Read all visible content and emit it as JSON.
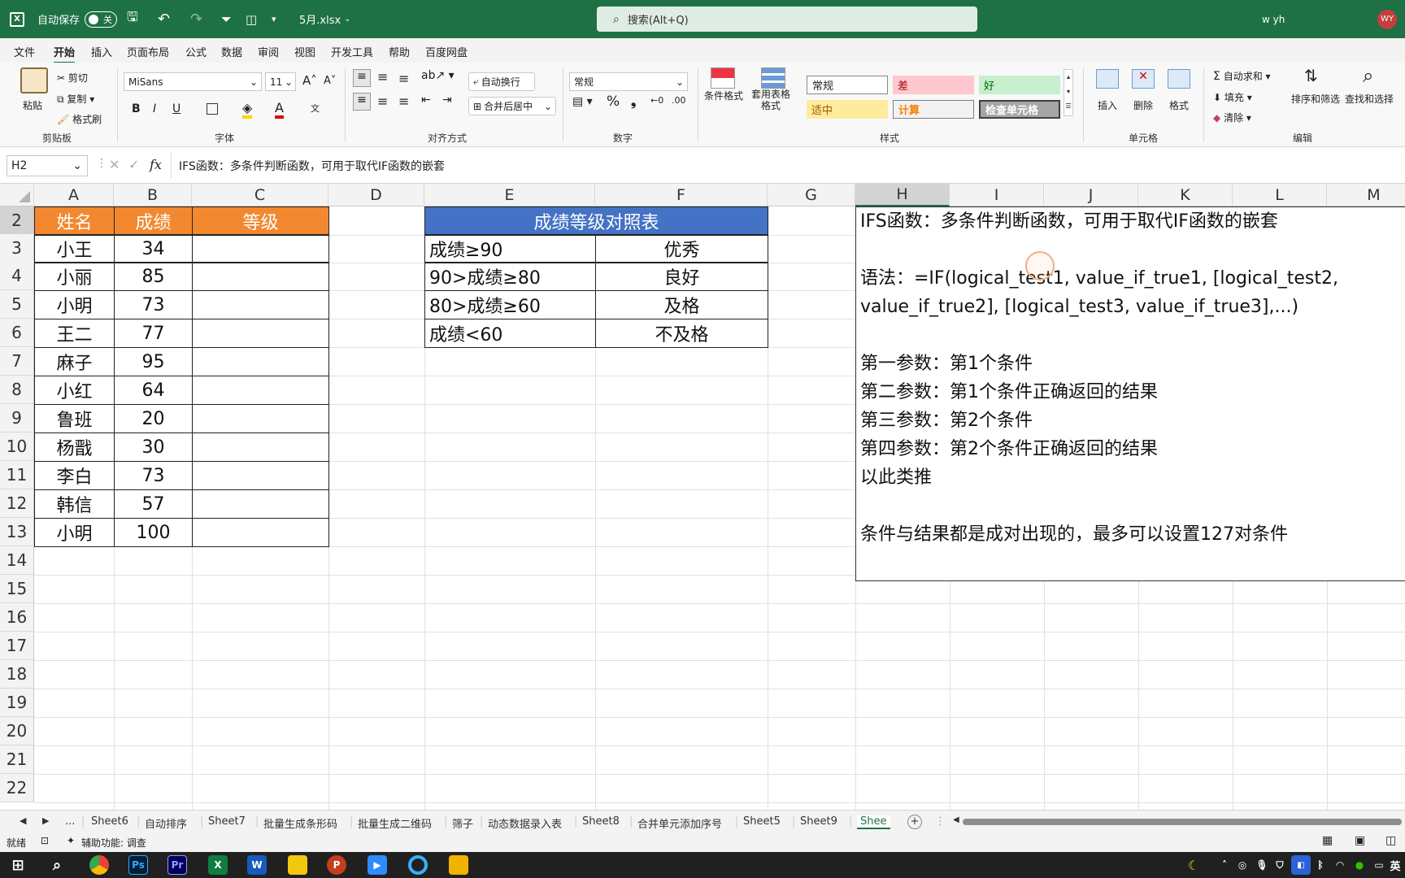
{
  "titlebar": {
    "autosave_label": "自动保存",
    "autosave_state": "关",
    "filename": "5月.xlsx",
    "search_placeholder": "搜索(Alt+Q)",
    "user_name": "w yh",
    "user_initials": "WY"
  },
  "menu": [
    "文件",
    "开始",
    "插入",
    "页面布局",
    "公式",
    "数据",
    "审阅",
    "视图",
    "开发工具",
    "帮助",
    "百度网盘"
  ],
  "ribbon": {
    "clipboard": {
      "paste": "粘贴",
      "cut": "剪切",
      "copy": "复制",
      "format_painter": "格式刷",
      "label": "剪贴板"
    },
    "font": {
      "name": "MiSans",
      "size": "11",
      "bold": "B",
      "italic": "I",
      "underline": "U",
      "label": "字体"
    },
    "alignment": {
      "wrap": "自动换行",
      "merge": "合并后居中",
      "label": "对齐方式"
    },
    "number": {
      "format": "常规",
      "percent": "%",
      "label": "数字"
    },
    "styles": {
      "cond_format": "条件格式",
      "table_format": "套用表格格式",
      "normal": "常规",
      "bad": "差",
      "good": "好",
      "neutral": "适中",
      "calc": "计算",
      "check": "检查单元格",
      "label": "样式"
    },
    "cells": {
      "insert": "插入",
      "delete": "删除",
      "format": "格式",
      "label": "单元格"
    },
    "editing": {
      "autosum": "自动求和",
      "fill": "填充",
      "clear": "清除",
      "sort": "排序和筛选",
      "find": "查找和选择",
      "label": "编辑"
    }
  },
  "formula_bar": {
    "name_box": "H2",
    "fx": "fx",
    "content": "IFS函数：多条件判断函数，可用于取代IF函数的嵌套"
  },
  "columns": [
    "A",
    "B",
    "C",
    "D",
    "E",
    "F",
    "G",
    "H",
    "I",
    "J",
    "K",
    "L",
    "M"
  ],
  "rows": [
    "2",
    "3",
    "4",
    "5",
    "6",
    "7",
    "8",
    "9",
    "10",
    "11",
    "12",
    "13",
    "14",
    "15",
    "16",
    "17",
    "18",
    "19",
    "20",
    "21",
    "22"
  ],
  "table1": {
    "headers": [
      "姓名",
      "成绩",
      "等级"
    ],
    "rows": [
      [
        "小王",
        "34"
      ],
      [
        "小丽",
        "85"
      ],
      [
        "小明",
        "73"
      ],
      [
        "王二",
        "77"
      ],
      [
        "麻子",
        "95"
      ],
      [
        "小红",
        "64"
      ],
      [
        "鲁班",
        "20"
      ],
      [
        "杨戬",
        "30"
      ],
      [
        "李白",
        "73"
      ],
      [
        "韩信",
        "57"
      ],
      [
        "小明",
        "100"
      ]
    ]
  },
  "table2": {
    "title": "成绩等级对照表",
    "rows": [
      [
        "成绩≥90",
        "优秀"
      ],
      [
        "90>成绩≥80",
        "良好"
      ],
      [
        "80>成绩≥60",
        "及格"
      ],
      [
        "成绩<60",
        "不及格"
      ]
    ]
  },
  "note": {
    "lines": [
      "IFS函数：多条件判断函数，可用于取代IF函数的嵌套",
      "",
      "语法：=IF(logical_test1, value_if_true1, [logical_test2,",
      "value_if_true2], [logical_test3, value_if_true3],...)",
      "",
      "第一参数：第1个条件",
      "第二参数：第1个条件正确返回的结果",
      "第三参数：第2个条件",
      "第四参数：第2个条件正确返回的结果",
      "以此类推",
      "",
      "条件与结果都是成对出现的，最多可以设置127对条件"
    ]
  },
  "sheet_tabs": [
    "Sheet6",
    "自动排序",
    "Sheet7",
    "批量生成条形码",
    "批量生成二维码",
    "筛子",
    "动态数据录入表",
    "Sheet8",
    "合并单元添加序号",
    "Sheet5",
    "Sheet9",
    "Shee"
  ],
  "status": {
    "ready": "就绪",
    "accessibility": "辅助功能: 调查"
  },
  "taskbar": {
    "lang": "英"
  },
  "colors": {
    "excel_green": "#1e7145",
    "orange_header": "#f2882f",
    "blue_header": "#4472c4"
  }
}
